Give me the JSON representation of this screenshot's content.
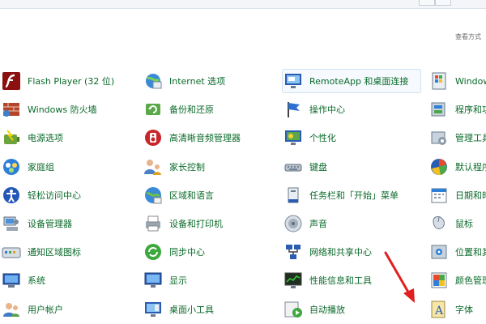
{
  "header": {
    "view_by": "查看方式"
  },
  "colors": {
    "label": "#0a6a2a",
    "arrow": "#e02020",
    "highlight_border": "#cfe0f2"
  },
  "columns": [
    {
      "items": [
        {
          "label": "Flash Player (32 位)",
          "icon": "flash-icon"
        },
        {
          "label": "Windows 防火墙",
          "icon": "firewall-icon"
        },
        {
          "label": "电源选项",
          "icon": "power-icon"
        },
        {
          "label": "家庭组",
          "icon": "homegroup-icon"
        },
        {
          "label": "轻松访问中心",
          "icon": "ease-of-access-icon"
        },
        {
          "label": "设备管理器",
          "icon": "device-manager-icon"
        },
        {
          "label": "通知区域图标",
          "icon": "notification-icon"
        },
        {
          "label": "系统",
          "icon": "system-icon"
        },
        {
          "label": "用户帐户",
          "icon": "user-accounts-icon"
        }
      ]
    },
    {
      "items": [
        {
          "label": "Internet 选项",
          "icon": "internet-options-icon"
        },
        {
          "label": "备份和还原",
          "icon": "backup-icon"
        },
        {
          "label": "高清晰音频管理器",
          "icon": "audio-manager-icon"
        },
        {
          "label": "家长控制",
          "icon": "parental-controls-icon"
        },
        {
          "label": "区域和语言",
          "icon": "region-language-icon"
        },
        {
          "label": "设备和打印机",
          "icon": "printer-icon"
        },
        {
          "label": "同步中心",
          "icon": "sync-icon"
        },
        {
          "label": "显示",
          "icon": "display-icon"
        },
        {
          "label": "桌面小工具",
          "icon": "gadgets-icon"
        }
      ]
    },
    {
      "items": [
        {
          "label": "RemoteApp 和桌面连接",
          "icon": "remoteapp-icon",
          "highlight": true
        },
        {
          "label": "操作中心",
          "icon": "action-center-icon"
        },
        {
          "label": "个性化",
          "icon": "personalization-icon"
        },
        {
          "label": "键盘",
          "icon": "keyboard-icon"
        },
        {
          "label": "任务栏和「开始」菜单",
          "icon": "taskbar-icon"
        },
        {
          "label": "声音",
          "icon": "sound-icon"
        },
        {
          "label": "网络和共享中心",
          "icon": "network-icon"
        },
        {
          "label": "性能信息和工具",
          "icon": "performance-icon"
        },
        {
          "label": "自动播放",
          "icon": "autoplay-icon"
        }
      ]
    },
    {
      "items": [
        {
          "label": "Window",
          "icon": "windows-update-icon"
        },
        {
          "label": "程序和功",
          "icon": "programs-icon"
        },
        {
          "label": "管理工具",
          "icon": "admin-tools-icon"
        },
        {
          "label": "默认程序",
          "icon": "default-programs-icon"
        },
        {
          "label": "日期和时",
          "icon": "date-time-icon"
        },
        {
          "label": "鼠标",
          "icon": "mouse-icon"
        },
        {
          "label": "位置和其",
          "icon": "location-icon"
        },
        {
          "label": "颜色管理",
          "icon": "color-management-icon"
        },
        {
          "label": "字体",
          "icon": "fonts-icon"
        }
      ]
    }
  ]
}
